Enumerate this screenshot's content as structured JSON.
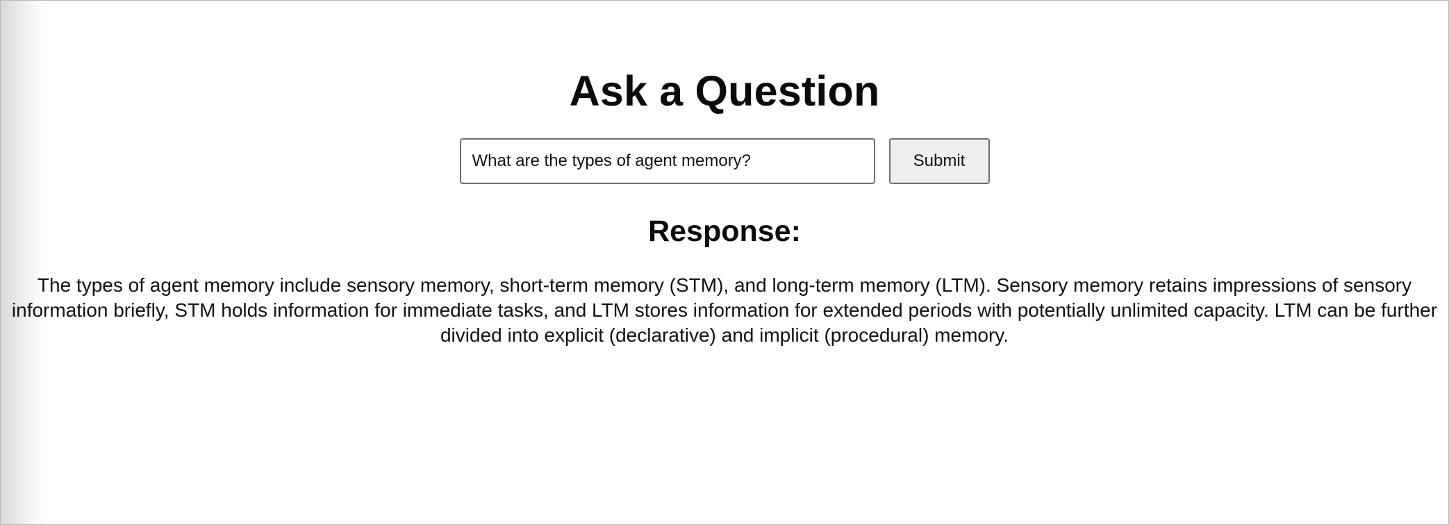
{
  "page": {
    "title": "Ask a Question"
  },
  "question": {
    "value": "What are the types of agent memory?",
    "placeholder": ""
  },
  "actions": {
    "submit_label": "Submit"
  },
  "response": {
    "heading": "Response:",
    "text": "The types of agent memory include sensory memory, short-term memory (STM), and long-term memory (LTM). Sensory memory retains impressions of sensory information briefly, STM holds information for immediate tasks, and LTM stores information for extended periods with potentially unlimited capacity. LTM can be further divided into explicit (declarative) and implicit (procedural) memory."
  },
  "colors": {
    "background": "#ffffff",
    "text": "#0b0b0b",
    "button_background": "#efefef",
    "border": "#6e6e6e"
  }
}
